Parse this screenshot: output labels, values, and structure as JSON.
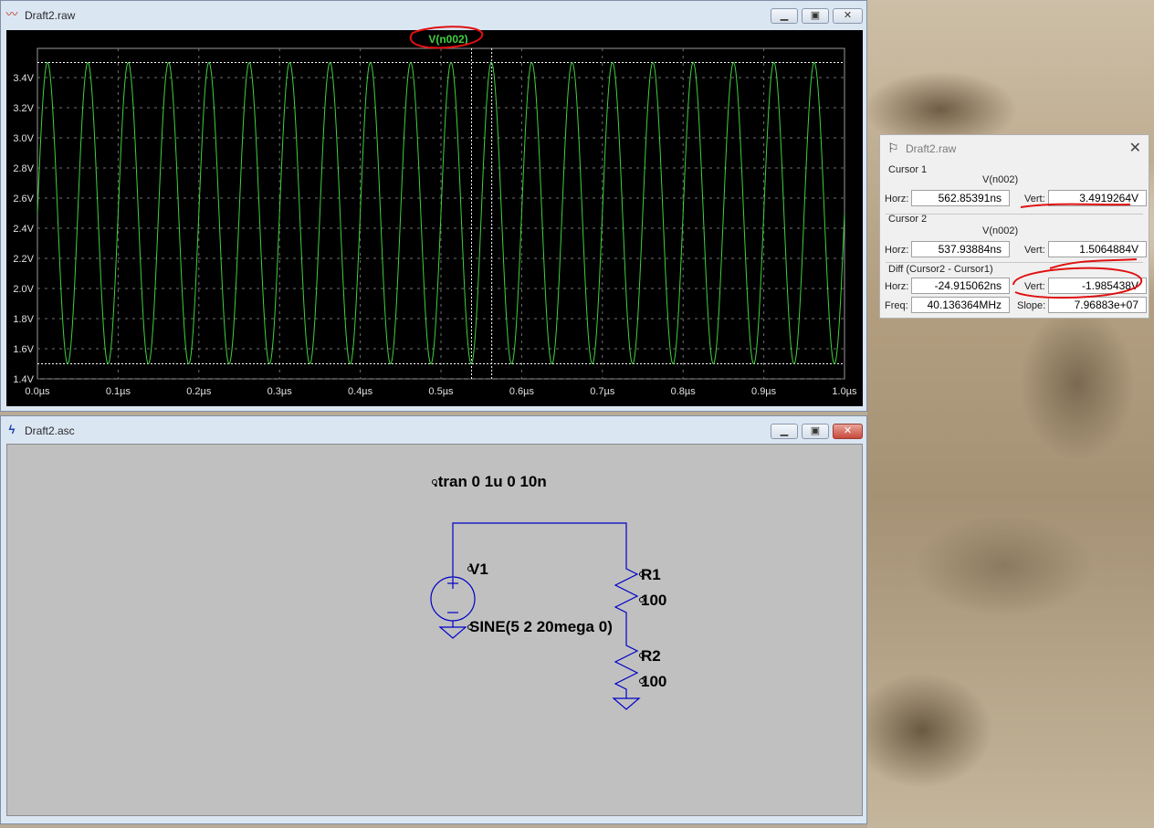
{
  "waveform_window": {
    "title": "Draft2.raw",
    "trace_label": "V(n002)",
    "y_ticks": [
      "3.4V",
      "3.2V",
      "3.0V",
      "2.8V",
      "2.6V",
      "2.4V",
      "2.2V",
      "2.0V",
      "1.8V",
      "1.6V",
      "1.4V"
    ],
    "x_ticks": [
      "0.0µs",
      "0.1µs",
      "0.2µs",
      "0.3µs",
      "0.4µs",
      "0.5µs",
      "0.6µs",
      "0.7µs",
      "0.8µs",
      "0.9µs",
      "1.0µs"
    ],
    "colors": {
      "trace": "#40d040",
      "background": "#000000",
      "grid": "#9a9a9a"
    },
    "waveform": {
      "offset_v": 2.5,
      "amplitude_v": 1.0,
      "frequency_mhz": 20,
      "x_range_us": [
        0,
        1
      ],
      "y_range_v": [
        1.4,
        3.6
      ]
    },
    "cursors_us": [
      0.5379,
      0.5629
    ],
    "cursor_levels_v": [
      1.5,
      3.5
    ]
  },
  "schematic_window": {
    "title": "Draft2.asc",
    "directive": ".tran 0 1u 0 10n",
    "v1": {
      "name": "V1",
      "value": "SINE(5 2 20mega 0)"
    },
    "r1": {
      "name": "R1",
      "value": "100"
    },
    "r2": {
      "name": "R2",
      "value": "100"
    },
    "colors": {
      "wire": "#0000c8",
      "background": "#c0c0c0"
    }
  },
  "cursor_dialog": {
    "title": "Draft2.raw",
    "cursor1": {
      "label": "Cursor 1",
      "trace": "V(n002)",
      "horz_label": "Horz:",
      "horz": "562.85391ns",
      "vert_label": "Vert:",
      "vert": "3.4919264V"
    },
    "cursor2": {
      "label": "Cursor 2",
      "trace": "V(n002)",
      "horz_label": "Horz:",
      "horz": "537.93884ns",
      "vert_label": "Vert:",
      "vert": "1.5064884V"
    },
    "diff": {
      "label": "Diff (Cursor2 - Cursor1)",
      "horz_label": "Horz:",
      "horz": "-24.915062ns",
      "vert_label": "Vert:",
      "vert": "-1.985438V",
      "freq_label": "Freq:",
      "freq": "40.136364MHz",
      "slope_label": "Slope:",
      "slope": "7.96883e+07"
    }
  }
}
